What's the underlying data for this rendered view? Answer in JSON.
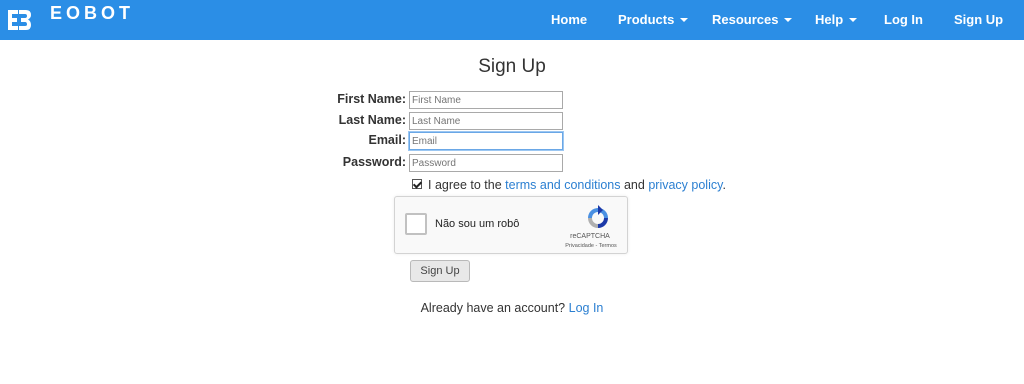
{
  "brand": {
    "name": "EOBOT",
    "icon": "eobot-logo-icon"
  },
  "nav": {
    "items": [
      {
        "label": "Home"
      },
      {
        "label": "Products",
        "dropdown": true
      },
      {
        "label": "Resources",
        "dropdown": true
      },
      {
        "label": "Help",
        "dropdown": true
      },
      {
        "label": "Log In"
      },
      {
        "label": "Sign Up"
      }
    ]
  },
  "form": {
    "title": "Sign Up",
    "fields": [
      {
        "label": "First Name:",
        "placeholder": "First Name",
        "value": ""
      },
      {
        "label": "Last Name:",
        "placeholder": "Last Name",
        "value": ""
      },
      {
        "label": "Email:",
        "placeholder": "Email",
        "value": "",
        "focused": true
      },
      {
        "label": "Password:",
        "placeholder": "Password",
        "value": ""
      }
    ],
    "agree": {
      "checked": true,
      "prefix": "I agree to the",
      "terms_link": "terms and conditions",
      "and": "and",
      "privacy_link": "privacy policy",
      "suffix": "."
    },
    "captcha": {
      "label": "Não sou um robô",
      "brand": "reCAPTCHA",
      "links": "Privacidade - Termos",
      "icon": "recaptcha-icon"
    },
    "submit_label": "Sign Up",
    "already": {
      "text": "Already have an account?",
      "link": "Log In"
    }
  },
  "colors": {
    "navbar": "#2b8ee6",
    "link": "#2b7fd1"
  }
}
